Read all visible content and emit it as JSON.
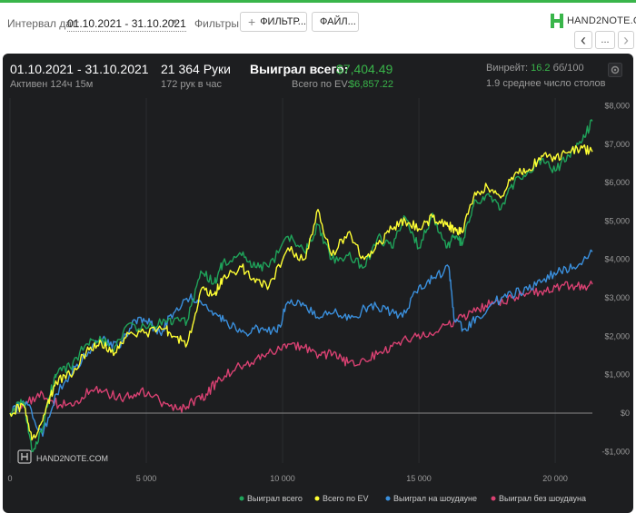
{
  "filters": {
    "interval_label": "Интервал дат:",
    "interval_value": "01.10.2021 - 31.10.2021",
    "filters_label": "Фильтры:",
    "filter_button": "ФИЛЬТР...",
    "file_button": "ФАЙЛ...",
    "logo_text": "HAND2NOTE.COM",
    "nav_prev": "‹",
    "nav_more": "...",
    "nav_next": "›"
  },
  "summary": {
    "period": "01.10.2021 - 31.10.2021",
    "active": "Активен 124ч 15м",
    "hands": "21 364 Руки",
    "hands_per_hour": "172 рук в час",
    "won_label": "Выиграл всего:",
    "won_value": "$7,404.49",
    "ev_label": "Всего по EV:",
    "ev_value": "$6,857.22",
    "winrate_label": "Винрейт:",
    "winrate_value": "16.2",
    "winrate_unit": "бб/100",
    "tables": "1.9 среднее число столов"
  },
  "watermark": "HAND2NOTE.COM",
  "colors": {
    "won": "#1fa35a",
    "ev": "#ffff33",
    "showdown": "#3a8fdc",
    "nonshowdown": "#d94172",
    "accent": "#39b54a"
  },
  "chart_data": {
    "type": "line",
    "title": "",
    "xlabel": "",
    "ylabel": "",
    "xlim": [
      0,
      21364
    ],
    "ylim": [
      -1300,
      8200
    ],
    "x_ticks": [
      0,
      5000,
      10000,
      15000,
      20000
    ],
    "x_tick_labels": [
      "0",
      "5 000",
      "10 000",
      "15 000",
      "20 000"
    ],
    "y_ticks": [
      -1000,
      0,
      1000,
      2000,
      3000,
      4000,
      5000,
      6000,
      7000,
      8000
    ],
    "y_tick_labels": [
      "-$1,000",
      "$0",
      "$1,000",
      "$2,000",
      "$3,000",
      "$4,000",
      "$5,000",
      "$6,000",
      "$7,000",
      "$8,000"
    ],
    "grid": "vertical",
    "legend_position": "bottom-right",
    "series": [
      {
        "name": "Выиграл всего",
        "color": "#1fa35a",
        "x": [
          0,
          500,
          800,
          1200,
          1500,
          1700,
          2200,
          2800,
          3300,
          3800,
          4300,
          5000,
          5700,
          6000,
          6500,
          7000,
          7500,
          7800,
          8500,
          9000,
          9500,
          10200,
          10800,
          11300,
          11800,
          12400,
          13000,
          13500,
          14000,
          14500,
          15000,
          15500,
          16000,
          16300,
          16600,
          17000,
          17500,
          18000,
          18500,
          19000,
          19500,
          20000,
          20500,
          21000,
          21364
        ],
        "y": [
          0,
          300,
          -1000,
          -400,
          600,
          1000,
          1200,
          1800,
          2000,
          1600,
          2300,
          2200,
          2400,
          2400,
          2400,
          3700,
          3400,
          3900,
          4100,
          3800,
          3800,
          4600,
          4200,
          4900,
          4000,
          4100,
          3800,
          4600,
          4300,
          5100,
          4300,
          5200,
          4300,
          4600,
          4400,
          5400,
          5700,
          5300,
          6000,
          6300,
          6600,
          6300,
          6700,
          7100,
          7600
        ]
      },
      {
        "name": "Всего по EV",
        "color": "#ffff33",
        "x": [
          0,
          500,
          800,
          1200,
          1500,
          1700,
          2200,
          2800,
          3300,
          3800,
          4300,
          5000,
          5700,
          6000,
          6500,
          7000,
          7500,
          7800,
          8500,
          9000,
          9500,
          10200,
          10800,
          11300,
          11800,
          12400,
          13000,
          13500,
          14000,
          14500,
          15000,
          15500,
          16000,
          16300,
          16600,
          17000,
          17500,
          18000,
          18500,
          19000,
          19500,
          20000,
          20500,
          21000,
          21364
        ],
        "y": [
          0,
          200,
          -700,
          -200,
          500,
          800,
          1000,
          1600,
          1900,
          1500,
          2100,
          2100,
          2200,
          2000,
          1800,
          3200,
          3100,
          3500,
          3800,
          3400,
          3300,
          4300,
          4000,
          5300,
          4100,
          4700,
          4000,
          4400,
          4800,
          5000,
          4800,
          5100,
          4900,
          4800,
          4700,
          5600,
          5900,
          5600,
          6200,
          6300,
          6700,
          6600,
          6800,
          6900,
          6800
        ]
      },
      {
        "name": "Выиграл на шоудауне",
        "color": "#3a8fdc",
        "x": [
          0,
          600,
          1200,
          1700,
          2400,
          3000,
          3500,
          4000,
          4500,
          5000,
          5500,
          6000,
          6600,
          7000,
          7500,
          8000,
          8600,
          9200,
          9800,
          10200,
          10800,
          11400,
          12000,
          12600,
          13200,
          13800,
          14400,
          15000,
          15500,
          16100,
          16300,
          16700,
          17200,
          17800,
          18400,
          19000,
          19600,
          20200,
          20800,
          21364
        ],
        "y": [
          0,
          300,
          -600,
          500,
          1200,
          1700,
          1900,
          1700,
          2400,
          2400,
          2100,
          2600,
          3000,
          2900,
          2600,
          2300,
          2100,
          2200,
          2100,
          2900,
          2800,
          2500,
          2600,
          2500,
          2800,
          2700,
          2500,
          3300,
          3500,
          3800,
          2400,
          2200,
          2500,
          2900,
          3100,
          3200,
          3500,
          3700,
          3800,
          4200
        ]
      },
      {
        "name": "Выиграл без шоудауна",
        "color": "#d94172",
        "x": [
          0,
          600,
          1200,
          1800,
          2400,
          3000,
          3600,
          4200,
          4800,
          5500,
          6200,
          6700,
          7200,
          7700,
          8300,
          9000,
          9600,
          10200,
          10800,
          11400,
          11900,
          12400,
          13000,
          13600,
          14200,
          14800,
          15400,
          16000,
          16600,
          17200,
          17800,
          18400,
          19000,
          19600,
          20200,
          20800,
          21364
        ],
        "y": [
          0,
          300,
          500,
          200,
          300,
          600,
          500,
          400,
          600,
          300,
          100,
          300,
          500,
          900,
          1200,
          1400,
          1600,
          1800,
          1700,
          1500,
          1600,
          1300,
          1400,
          1600,
          1800,
          2000,
          2100,
          2300,
          2500,
          2700,
          2900,
          3000,
          3100,
          3200,
          3300,
          3300,
          3350
        ]
      }
    ]
  }
}
